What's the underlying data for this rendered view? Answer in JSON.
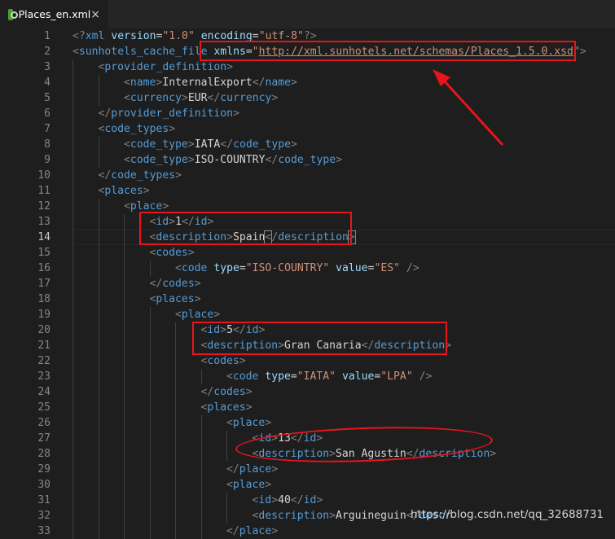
{
  "tab": {
    "filename": "Places_en.xml",
    "close_glyph": "×",
    "icon": "xml-file-icon"
  },
  "editor": {
    "current_line": 14
  },
  "colors": {
    "background": "#1e1e1e",
    "tag": "#569cd6",
    "attribute": "#9cdcfe",
    "string": "#ce9178",
    "bracket": "#808080",
    "text": "#d4d4d4",
    "annotation": "#e8141b"
  },
  "lines": [
    {
      "n": 1,
      "indent": 0,
      "tokens": [
        [
          "b",
          "<?"
        ],
        [
          "t",
          "xml"
        ],
        [
          "x",
          " "
        ],
        [
          "a",
          "version"
        ],
        [
          "x",
          "="
        ],
        [
          "s",
          "\"1.0\""
        ],
        [
          "x",
          " "
        ],
        [
          "a",
          "encoding"
        ],
        [
          "x",
          "="
        ],
        [
          "s",
          "\"utf-8\""
        ],
        [
          "b",
          "?>"
        ]
      ]
    },
    {
      "n": 2,
      "indent": 0,
      "tokens": [
        [
          "b",
          "<"
        ],
        [
          "t",
          "sunhotels_cache_file"
        ],
        [
          "x",
          " "
        ],
        [
          "a",
          "xmlns"
        ],
        [
          "x",
          "="
        ],
        [
          "s",
          "\""
        ],
        [
          "su",
          "http://xml.sunhotels.net/schemas/Places_1.5.0.xsd"
        ],
        [
          "s",
          "\""
        ],
        [
          "b",
          ">"
        ]
      ]
    },
    {
      "n": 3,
      "indent": 1,
      "tokens": [
        [
          "b",
          "<"
        ],
        [
          "t",
          "provider_definition"
        ],
        [
          "b",
          ">"
        ]
      ]
    },
    {
      "n": 4,
      "indent": 2,
      "tokens": [
        [
          "b",
          "<"
        ],
        [
          "t",
          "name"
        ],
        [
          "b",
          ">"
        ],
        [
          "x",
          "InternalExport"
        ],
        [
          "b",
          "</"
        ],
        [
          "t",
          "name"
        ],
        [
          "b",
          ">"
        ]
      ]
    },
    {
      "n": 5,
      "indent": 2,
      "tokens": [
        [
          "b",
          "<"
        ],
        [
          "t",
          "currency"
        ],
        [
          "b",
          ">"
        ],
        [
          "x",
          "EUR"
        ],
        [
          "b",
          "</"
        ],
        [
          "t",
          "currency"
        ],
        [
          "b",
          ">"
        ]
      ]
    },
    {
      "n": 6,
      "indent": 1,
      "tokens": [
        [
          "b",
          "</"
        ],
        [
          "t",
          "provider_definition"
        ],
        [
          "b",
          ">"
        ]
      ]
    },
    {
      "n": 7,
      "indent": 1,
      "tokens": [
        [
          "b",
          "<"
        ],
        [
          "t",
          "code_types"
        ],
        [
          "b",
          ">"
        ]
      ]
    },
    {
      "n": 8,
      "indent": 2,
      "tokens": [
        [
          "b",
          "<"
        ],
        [
          "t",
          "code_type"
        ],
        [
          "b",
          ">"
        ],
        [
          "x",
          "IATA"
        ],
        [
          "b",
          "</"
        ],
        [
          "t",
          "code_type"
        ],
        [
          "b",
          ">"
        ]
      ]
    },
    {
      "n": 9,
      "indent": 2,
      "tokens": [
        [
          "b",
          "<"
        ],
        [
          "t",
          "code_type"
        ],
        [
          "b",
          ">"
        ],
        [
          "x",
          "ISO-COUNTRY"
        ],
        [
          "b",
          "</"
        ],
        [
          "t",
          "code_type"
        ],
        [
          "b",
          ">"
        ]
      ]
    },
    {
      "n": 10,
      "indent": 1,
      "tokens": [
        [
          "b",
          "</"
        ],
        [
          "t",
          "code_types"
        ],
        [
          "b",
          ">"
        ]
      ]
    },
    {
      "n": 11,
      "indent": 1,
      "tokens": [
        [
          "b",
          "<"
        ],
        [
          "t",
          "places"
        ],
        [
          "b",
          ">"
        ]
      ]
    },
    {
      "n": 12,
      "indent": 2,
      "tokens": [
        [
          "b",
          "<"
        ],
        [
          "t",
          "place"
        ],
        [
          "b",
          ">"
        ]
      ]
    },
    {
      "n": 13,
      "indent": 3,
      "tokens": [
        [
          "b",
          "<"
        ],
        [
          "t",
          "id"
        ],
        [
          "b",
          ">"
        ],
        [
          "x",
          "1"
        ],
        [
          "b",
          "</"
        ],
        [
          "t",
          "id"
        ],
        [
          "b",
          ">"
        ]
      ]
    },
    {
      "n": 14,
      "indent": 3,
      "tokens": [
        [
          "b",
          "<"
        ],
        [
          "t",
          "description"
        ],
        [
          "b",
          ">"
        ],
        [
          "x",
          "Spain"
        ],
        [
          "bm",
          "<"
        ],
        [
          "b",
          "/"
        ],
        [
          "t",
          "description"
        ],
        [
          "bm",
          ">"
        ]
      ]
    },
    {
      "n": 15,
      "indent": 3,
      "tokens": [
        [
          "b",
          "<"
        ],
        [
          "t",
          "codes"
        ],
        [
          "b",
          ">"
        ]
      ]
    },
    {
      "n": 16,
      "indent": 4,
      "tokens": [
        [
          "b",
          "<"
        ],
        [
          "t",
          "code"
        ],
        [
          "x",
          " "
        ],
        [
          "a",
          "type"
        ],
        [
          "x",
          "="
        ],
        [
          "s",
          "\"ISO-COUNTRY\""
        ],
        [
          "x",
          " "
        ],
        [
          "a",
          "value"
        ],
        [
          "x",
          "="
        ],
        [
          "s",
          "\"ES\""
        ],
        [
          "x",
          " "
        ],
        [
          "b",
          "/>"
        ]
      ]
    },
    {
      "n": 17,
      "indent": 3,
      "tokens": [
        [
          "b",
          "</"
        ],
        [
          "t",
          "codes"
        ],
        [
          "b",
          ">"
        ]
      ]
    },
    {
      "n": 18,
      "indent": 3,
      "tokens": [
        [
          "b",
          "<"
        ],
        [
          "t",
          "places"
        ],
        [
          "b",
          ">"
        ]
      ]
    },
    {
      "n": 19,
      "indent": 4,
      "tokens": [
        [
          "b",
          "<"
        ],
        [
          "t",
          "place"
        ],
        [
          "b",
          ">"
        ]
      ]
    },
    {
      "n": 20,
      "indent": 5,
      "tokens": [
        [
          "b",
          "<"
        ],
        [
          "t",
          "id"
        ],
        [
          "b",
          ">"
        ],
        [
          "x",
          "5"
        ],
        [
          "b",
          "</"
        ],
        [
          "t",
          "id"
        ],
        [
          "b",
          ">"
        ]
      ]
    },
    {
      "n": 21,
      "indent": 5,
      "tokens": [
        [
          "b",
          "<"
        ],
        [
          "t",
          "description"
        ],
        [
          "b",
          ">"
        ],
        [
          "x",
          "Gran Canaria"
        ],
        [
          "b",
          "</"
        ],
        [
          "t",
          "description"
        ],
        [
          "b",
          ">"
        ]
      ]
    },
    {
      "n": 22,
      "indent": 5,
      "tokens": [
        [
          "b",
          "<"
        ],
        [
          "t",
          "codes"
        ],
        [
          "b",
          ">"
        ]
      ]
    },
    {
      "n": 23,
      "indent": 6,
      "tokens": [
        [
          "b",
          "<"
        ],
        [
          "t",
          "code"
        ],
        [
          "x",
          " "
        ],
        [
          "a",
          "type"
        ],
        [
          "x",
          "="
        ],
        [
          "s",
          "\"IATA\""
        ],
        [
          "x",
          " "
        ],
        [
          "a",
          "value"
        ],
        [
          "x",
          "="
        ],
        [
          "s",
          "\"LPA\""
        ],
        [
          "x",
          " "
        ],
        [
          "b",
          "/>"
        ]
      ]
    },
    {
      "n": 24,
      "indent": 5,
      "tokens": [
        [
          "b",
          "</"
        ],
        [
          "t",
          "codes"
        ],
        [
          "b",
          ">"
        ]
      ]
    },
    {
      "n": 25,
      "indent": 5,
      "tokens": [
        [
          "b",
          "<"
        ],
        [
          "t",
          "places"
        ],
        [
          "b",
          ">"
        ]
      ]
    },
    {
      "n": 26,
      "indent": 6,
      "tokens": [
        [
          "b",
          "<"
        ],
        [
          "t",
          "place"
        ],
        [
          "b",
          ">"
        ]
      ]
    },
    {
      "n": 27,
      "indent": 7,
      "tokens": [
        [
          "b",
          "<"
        ],
        [
          "t",
          "id"
        ],
        [
          "b",
          ">"
        ],
        [
          "x",
          "13"
        ],
        [
          "b",
          "</"
        ],
        [
          "t",
          "id"
        ],
        [
          "b",
          ">"
        ]
      ]
    },
    {
      "n": 28,
      "indent": 7,
      "tokens": [
        [
          "b",
          "<"
        ],
        [
          "t",
          "description"
        ],
        [
          "b",
          ">"
        ],
        [
          "x",
          "San Agustin"
        ],
        [
          "b",
          "</"
        ],
        [
          "t",
          "description"
        ],
        [
          "b",
          ">"
        ]
      ]
    },
    {
      "n": 29,
      "indent": 6,
      "tokens": [
        [
          "b",
          "</"
        ],
        [
          "t",
          "place"
        ],
        [
          "b",
          ">"
        ]
      ]
    },
    {
      "n": 30,
      "indent": 6,
      "tokens": [
        [
          "b",
          "<"
        ],
        [
          "t",
          "place"
        ],
        [
          "b",
          ">"
        ]
      ]
    },
    {
      "n": 31,
      "indent": 7,
      "tokens": [
        [
          "b",
          "<"
        ],
        [
          "t",
          "id"
        ],
        [
          "b",
          ">"
        ],
        [
          "x",
          "40"
        ],
        [
          "b",
          "</"
        ],
        [
          "t",
          "id"
        ],
        [
          "b",
          ">"
        ]
      ]
    },
    {
      "n": 32,
      "indent": 7,
      "tokens": [
        [
          "b",
          "<"
        ],
        [
          "t",
          "description"
        ],
        [
          "b",
          ">"
        ],
        [
          "x",
          "Arguineguin"
        ],
        [
          "b",
          "</"
        ],
        [
          "t",
          "descr"
        ]
      ]
    },
    {
      "n": 33,
      "indent": 6,
      "tokens": [
        [
          "b",
          "</"
        ],
        [
          "t",
          "place"
        ],
        [
          "b",
          ">"
        ]
      ]
    }
  ],
  "watermark": "https://blog.csdn.net/qq_32688731"
}
